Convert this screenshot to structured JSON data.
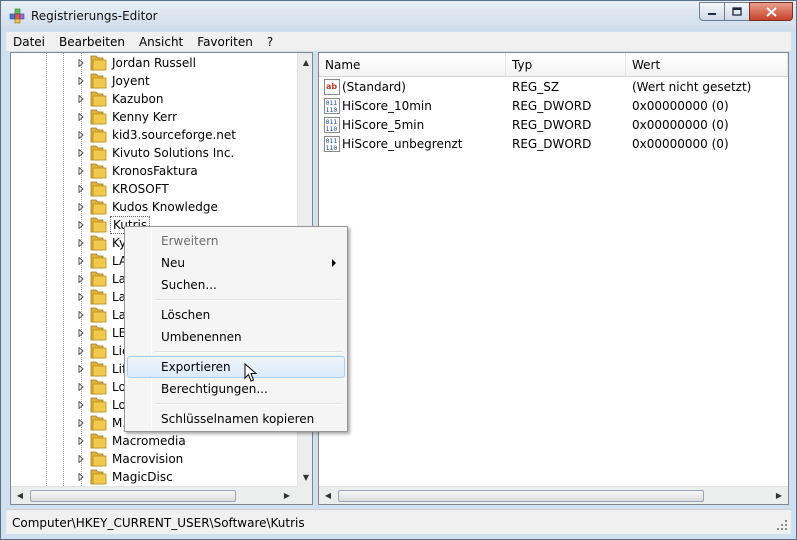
{
  "window": {
    "title": "Registrierungs-Editor"
  },
  "menubar": {
    "items": [
      "Datei",
      "Bearbeiten",
      "Ansicht",
      "Favoriten",
      "?"
    ]
  },
  "tree": {
    "items": [
      {
        "label": "Jordan Russell"
      },
      {
        "label": "Joyent"
      },
      {
        "label": "Kazubon"
      },
      {
        "label": "Kenny Kerr"
      },
      {
        "label": "kid3.sourceforge.net"
      },
      {
        "label": "Kivuto Solutions Inc."
      },
      {
        "label": "KronosFaktura"
      },
      {
        "label": "KROSOFT"
      },
      {
        "label": "Kudos Knowledge"
      },
      {
        "label": "Kutris"
      },
      {
        "label": "Ky"
      },
      {
        "label": "LA"
      },
      {
        "label": "La"
      },
      {
        "label": "La"
      },
      {
        "label": "La"
      },
      {
        "label": "LE"
      },
      {
        "label": "Lic"
      },
      {
        "label": "Lif"
      },
      {
        "label": "Lo"
      },
      {
        "label": "Lo"
      },
      {
        "label": "M."
      },
      {
        "label": "Macromedia"
      },
      {
        "label": "Macrovision"
      },
      {
        "label": "MagicDisc"
      }
    ]
  },
  "values": {
    "columns": [
      "Name",
      "Typ",
      "Wert"
    ],
    "rows": [
      {
        "icon": "string-value-icon",
        "name": "(Standard)",
        "type": "REG_SZ",
        "value": "(Wert nicht gesetzt)"
      },
      {
        "icon": "binary-value-icon",
        "name": "HiScore_10min",
        "type": "REG_DWORD",
        "value": "0x00000000 (0)"
      },
      {
        "icon": "binary-value-icon",
        "name": "HiScore_5min",
        "type": "REG_DWORD",
        "value": "0x00000000 (0)"
      },
      {
        "icon": "binary-value-icon",
        "name": "HiScore_unbegrenzt",
        "type": "REG_DWORD",
        "value": "0x00000000 (0)"
      }
    ]
  },
  "context_menu": {
    "expand": "Erweitern",
    "new": "Neu",
    "search": "Suchen...",
    "delete": "Löschen",
    "rename": "Umbenennen",
    "export": "Exportieren",
    "permissions": "Berechtigungen...",
    "copy_key_name": "Schlüsselnamen kopieren"
  },
  "statusbar": {
    "path": "Computer\\HKEY_CURRENT_USER\\Software\\Kutris"
  },
  "colors": {
    "selection_hover": "#dcebfb",
    "folder": "#f2c94c"
  }
}
